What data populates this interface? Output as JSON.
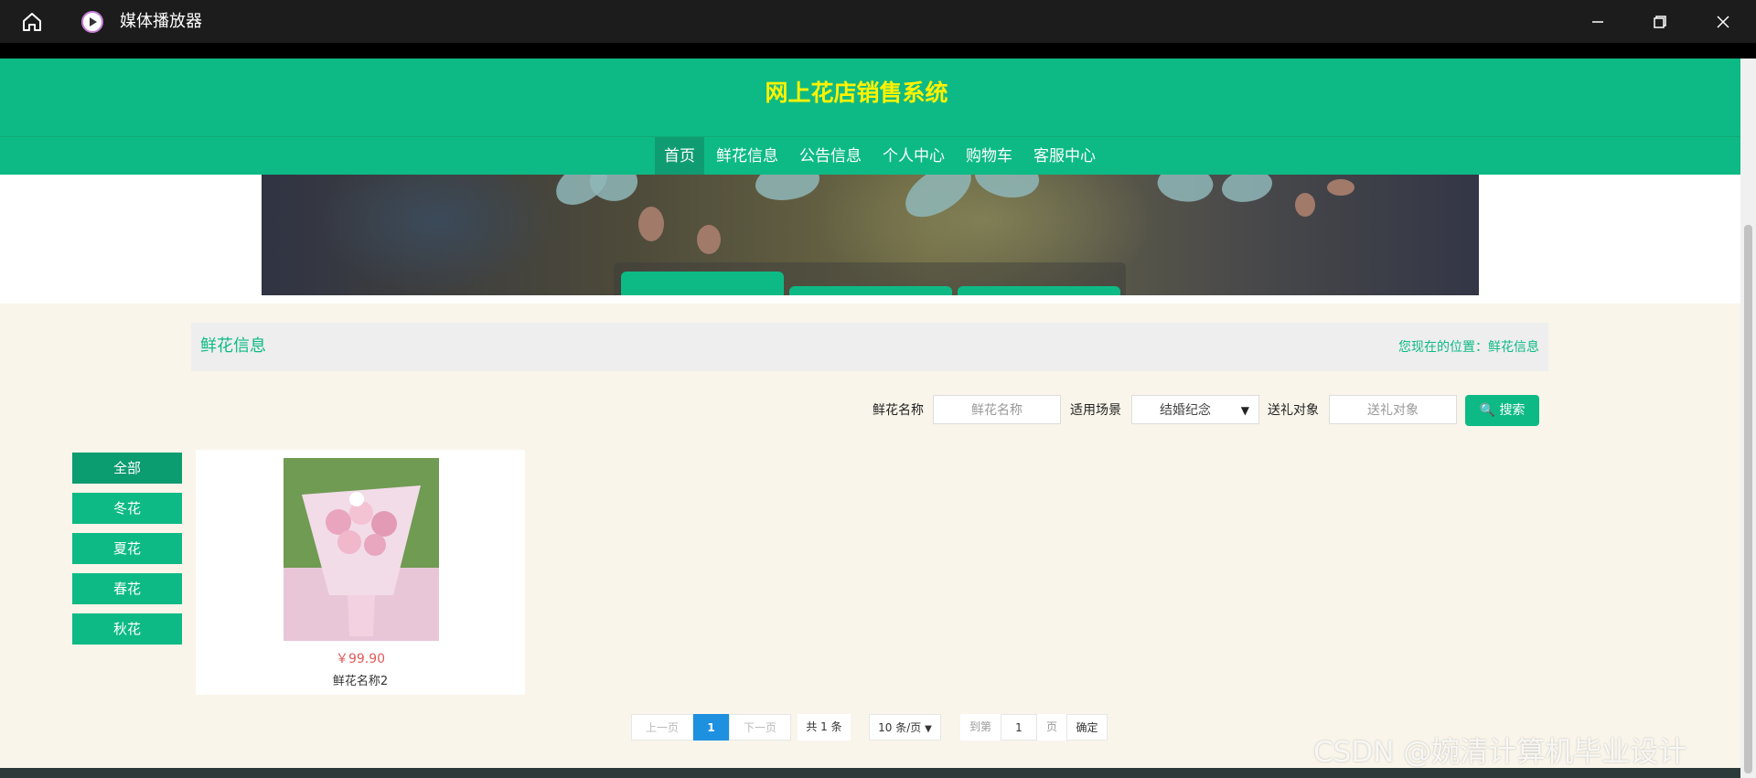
{
  "window": {
    "title": "媒体播放器"
  },
  "site": {
    "title": "网上花店销售系统"
  },
  "nav": [
    {
      "label": "首页",
      "active": true
    },
    {
      "label": "鲜花信息",
      "active": false
    },
    {
      "label": "公告信息",
      "active": false
    },
    {
      "label": "个人中心",
      "active": false
    },
    {
      "label": "购物车",
      "active": false
    },
    {
      "label": "客服中心",
      "active": false
    }
  ],
  "breadcrumb": {
    "title": "鲜花信息",
    "location": "您现在的位置：鲜花信息"
  },
  "search": {
    "name_label": "鲜花名称",
    "name_placeholder": "鲜花名称",
    "scene_label": "适用场景",
    "scene_value": "结婚纪念",
    "target_label": "送礼对象",
    "target_placeholder": "送礼对象",
    "button_label": "搜索"
  },
  "categories": [
    {
      "label": "全部",
      "active": true
    },
    {
      "label": "冬花",
      "active": false
    },
    {
      "label": "夏花",
      "active": false
    },
    {
      "label": "春花",
      "active": false
    },
    {
      "label": "秋花",
      "active": false
    }
  ],
  "products": [
    {
      "price": "￥99.90",
      "name": "鲜花名称2"
    }
  ],
  "pagination": {
    "prev": "上一页",
    "current": "1",
    "next": "下一页",
    "total": "共 1 条",
    "page_size": "10 条/页",
    "goto": "到第",
    "goto_value": "1",
    "page_unit": "页",
    "confirm": "确定"
  },
  "watermark": "CSDN @婉清计算机毕业设计",
  "colors": {
    "primary": "#0dba85",
    "title": "#fff200",
    "price": "#e25b5b",
    "page_active": "#1e90e0"
  }
}
